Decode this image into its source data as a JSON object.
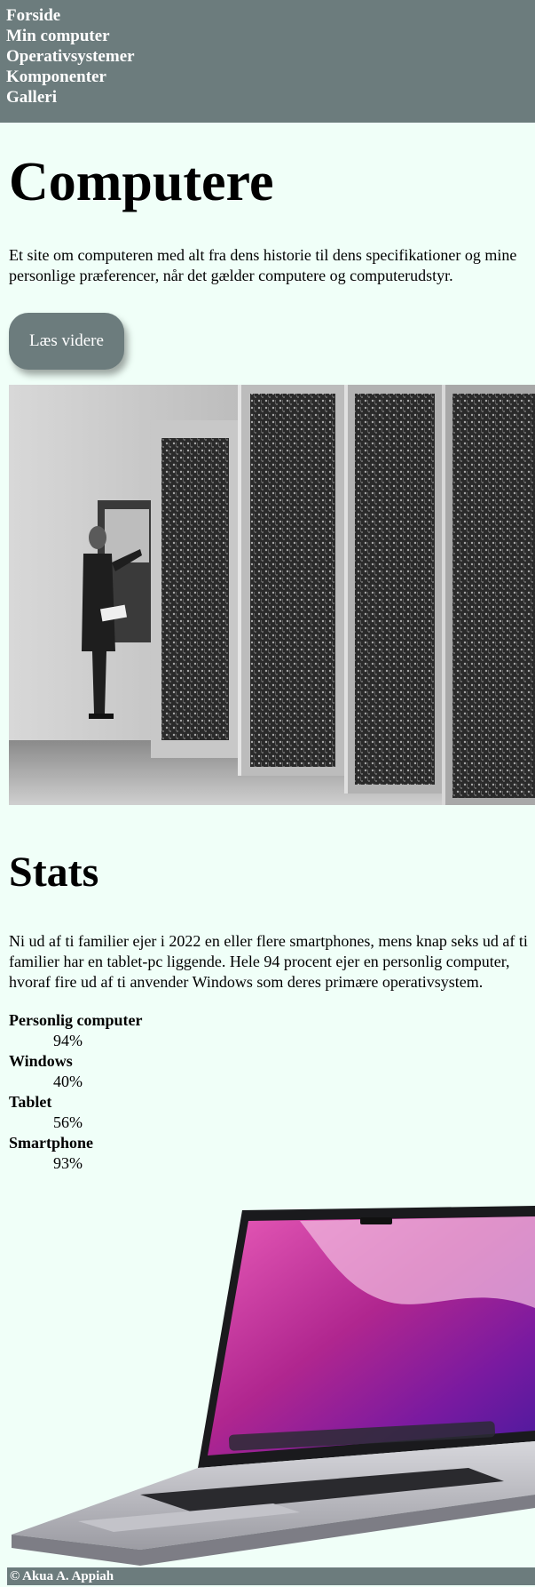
{
  "nav": {
    "items": [
      {
        "label": "Forside"
      },
      {
        "label": "Min computer"
      },
      {
        "label": "Operativsystemer"
      },
      {
        "label": "Komponenter"
      },
      {
        "label": "Galleri"
      }
    ]
  },
  "hero": {
    "title": "Computere",
    "intro": "Et site om computeren med alt fra dens historie til dens specifikationer og mine personlige præferencer, når det gælder computere og computerudstyr.",
    "button_label": "Læs videre"
  },
  "stats": {
    "heading": "Stats",
    "text": "Ni ud af ti familier ejer i 2022 en eller flere smartphones, mens knap seks ud af ti familier har en tablet-pc liggende. Hele 94 procent ejer en personlig computer, hvoraf fire ud af ti anvender Windows som deres primære operativsystem.",
    "items": [
      {
        "term": "Personlig computer",
        "value": "94%"
      },
      {
        "term": "Windows",
        "value": "40%"
      },
      {
        "term": "Tablet",
        "value": "56%"
      },
      {
        "term": "Smartphone",
        "value": "93%"
      }
    ]
  },
  "footer": {
    "text": "© Akua A. Appiah"
  },
  "colors": {
    "nav_bg": "#6c7c7d",
    "page_bg": "#f0fff8"
  }
}
